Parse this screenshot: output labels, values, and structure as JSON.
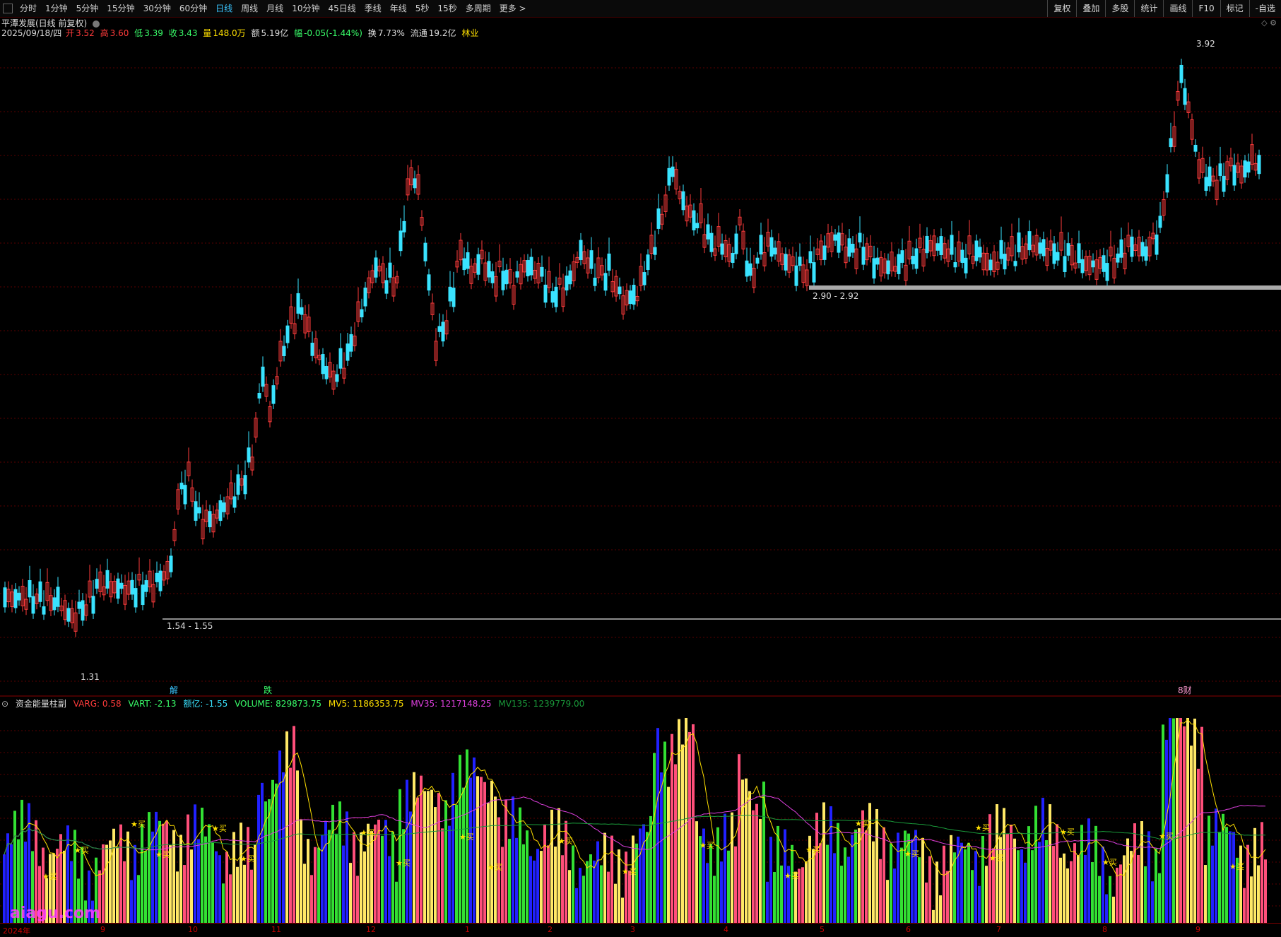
{
  "toolbar": {
    "periods": [
      "分时",
      "1分钟",
      "5分钟",
      "15分钟",
      "30分钟",
      "60分钟",
      "日线",
      "周线",
      "月线",
      "10分钟",
      "45日线",
      "季线",
      "年线",
      "5秒",
      "15秒",
      "多周期",
      "更多 >"
    ],
    "active_period": "日线",
    "tools": [
      "复权",
      "叠加",
      "多股",
      "统计",
      "画线",
      "F10",
      "标记",
      "-自选"
    ]
  },
  "stock": {
    "title": "平潭发展(日线 前复权)",
    "date": "2025/09/18/四",
    "open_label": "开",
    "open": "3.52",
    "high_label": "高",
    "high": "3.60",
    "low_label": "低",
    "low": "3.39",
    "close_label": "收",
    "close": "3.43",
    "vol_label": "量",
    "vol": "148.0万",
    "amt_label": "额",
    "amt": "5.19亿",
    "chg_label": "幅",
    "chg": "-0.05(-1.44%)",
    "turnover_label": "换",
    "turnover": "7.73%",
    "float_label": "流通",
    "float": "19.2亿",
    "industry": "林业"
  },
  "price_labels": {
    "max": "3.92",
    "min": "1.31",
    "range_low": "1.54 - 1.55",
    "range_high": "2.90 - 2.92"
  },
  "event_markers": [
    {
      "text": "解",
      "color": "#39c5ff"
    },
    {
      "text": "跌",
      "color": "#39ff6a"
    },
    {
      "text": "8财",
      "color": "#ff9ad0"
    }
  ],
  "indicator": {
    "name": "资金能量柱副",
    "varg": "VARG: 0.58",
    "vart": "VART: -2.13",
    "amt": "额亿: -1.55",
    "volume": "VOLUME: 829873.75",
    "mv5": "MV5: 1186353.75",
    "mv35": "MV35: 1217148.25",
    "mv135": "MV135: 1239779.00"
  },
  "colors": {
    "up": "#ff3b3b",
    "down": "#39e3ff",
    "bar_red": "#ff4f7a",
    "bar_yellow": "#ffe866",
    "bar_green": "#33e033",
    "bar_blue": "#2121ff",
    "mv5": "#ffe000",
    "mv35": "#e040e0",
    "mv135": "#1a9a3a"
  },
  "xaxis_labels": [
    "2024年",
    "9",
    "10",
    "11",
    "12",
    "1",
    "2",
    "3",
    "4",
    "5",
    "6",
    "7",
    "8",
    "9"
  ],
  "buy_label": "买",
  "watermark": "aiagu.com"
}
